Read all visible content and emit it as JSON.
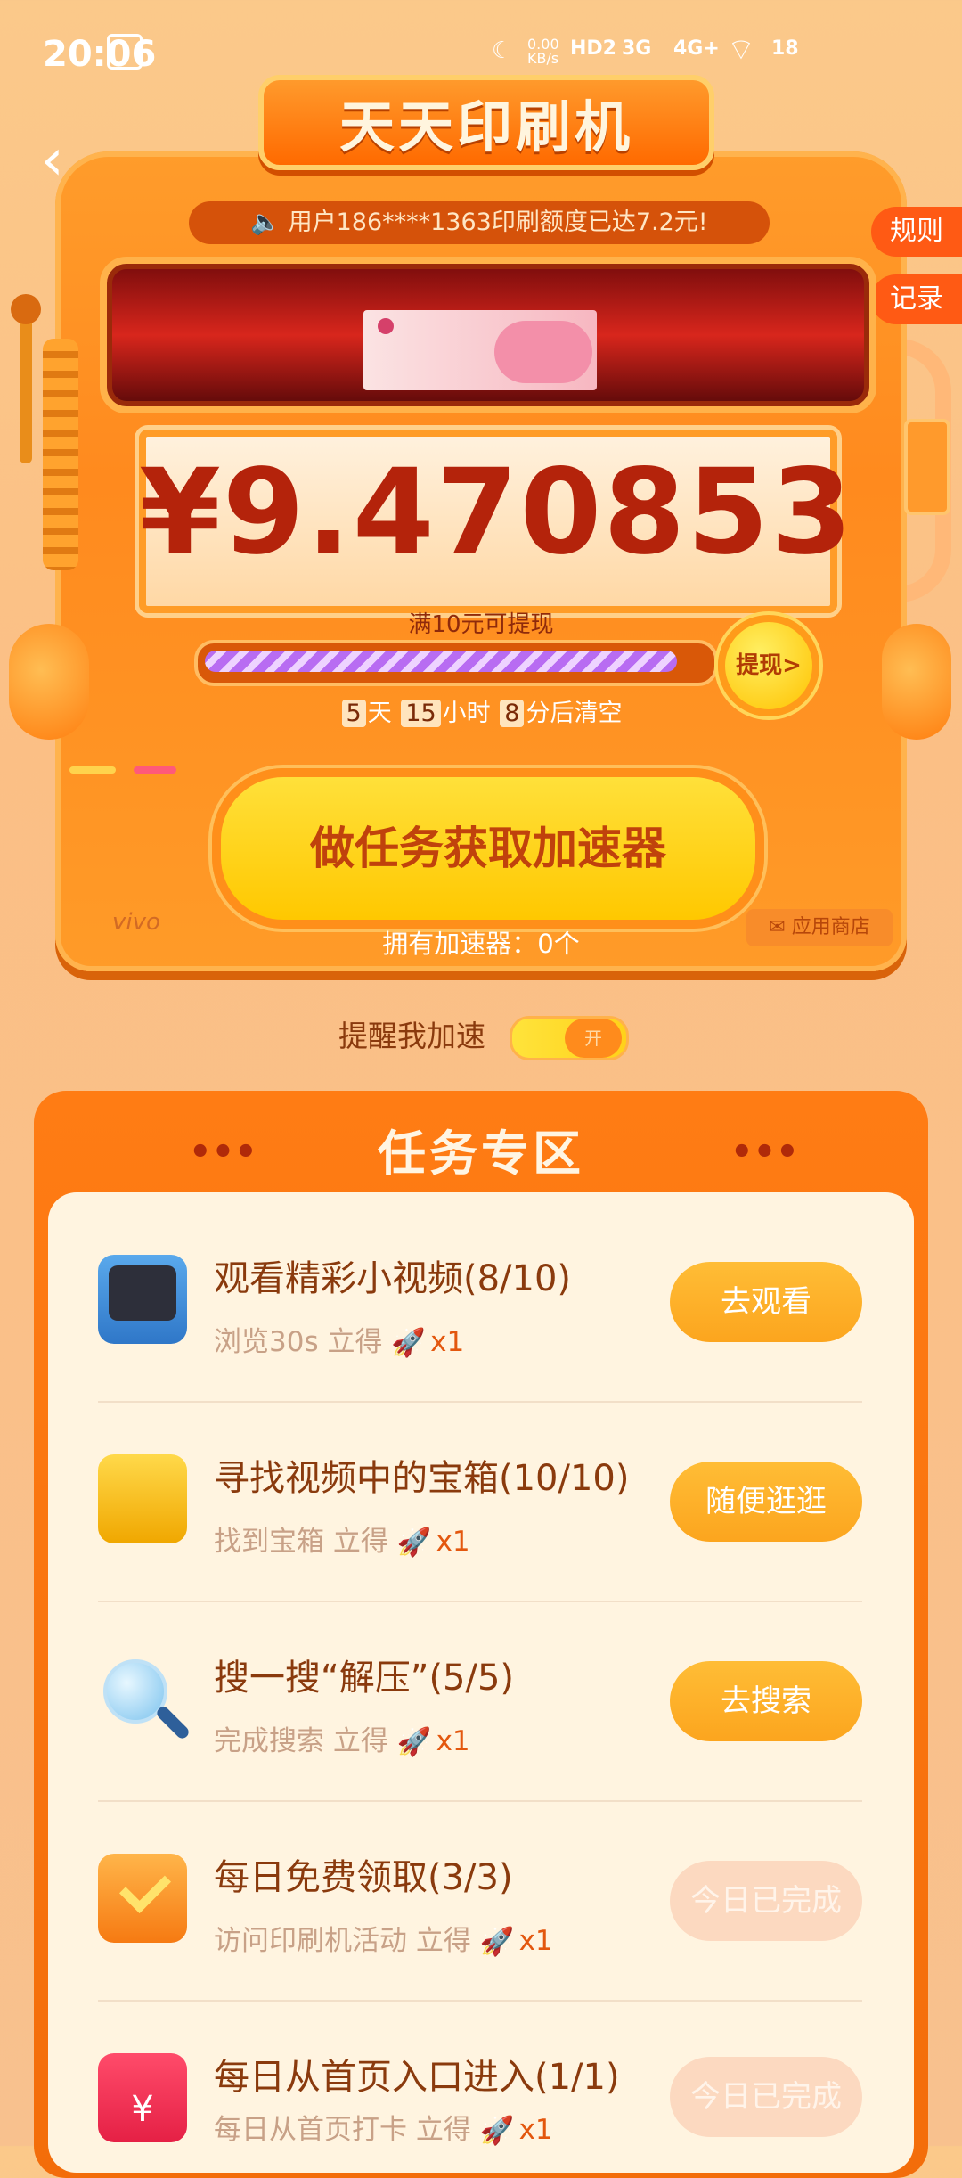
{
  "status_bar": {
    "time": "20:06",
    "net_speed": "0.00\nKB/s",
    "hd": "HD2",
    "sig1": "3G",
    "sig2": "4G+",
    "battery": "18"
  },
  "header": {
    "title": "天天印刷机"
  },
  "tabs": {
    "rules": "规则",
    "records": "记录"
  },
  "machine": {
    "notice": "用户186****1363印刷额度已达7.2元!",
    "amount": "¥9.470853",
    "threshold_text": "满10元可提现",
    "progress": 0.947,
    "withdraw_label": "提现>",
    "countdown": {
      "days": "5",
      "days_unit": "天",
      "hours": "15",
      "hours_unit": "小时",
      "minutes": "8",
      "minutes_unit": "分后清空"
    },
    "boost_button": "做任务获取加速器",
    "brand": "vivo",
    "store_label": "应用商店",
    "boosters_text": "拥有加速器：0个"
  },
  "reminder": {
    "label": "提醒我加速",
    "toggle_text": "开"
  },
  "tasks": {
    "title": "任务专区",
    "dots": "•••",
    "items": [
      {
        "title": "观看精彩小视频(8/10)",
        "sub": "浏览30s 立得",
        "reward": "x1",
        "button": "去观看",
        "done": false,
        "icon": "tv-icon"
      },
      {
        "title": "寻找视频中的宝箱(10/10)",
        "sub": "找到宝箱 立得",
        "reward": "x1",
        "button": "随便逛逛",
        "done": false,
        "icon": "treasure-chest-icon"
      },
      {
        "title": "搜一搜“解压”(5/5)",
        "sub": "完成搜索 立得",
        "reward": "x1",
        "button": "去搜索",
        "done": false,
        "icon": "magnifier-icon"
      },
      {
        "title": "每日免费领取(3/3)",
        "sub": "访问印刷机活动 立得",
        "reward": "x1",
        "button": "今日已完成",
        "done": true,
        "icon": "calendar-check-icon"
      },
      {
        "title": "每日从首页入口进入(1/1)",
        "sub": "每日从首页打卡 立得",
        "reward": "x1",
        "button": "今日已完成",
        "done": true,
        "icon": "red-envelope-icon"
      }
    ]
  },
  "colors": {
    "accent": "#ff7c14",
    "primary_text": "#8a3a0d",
    "amount": "#b4230b",
    "button": "#fcaa22"
  }
}
